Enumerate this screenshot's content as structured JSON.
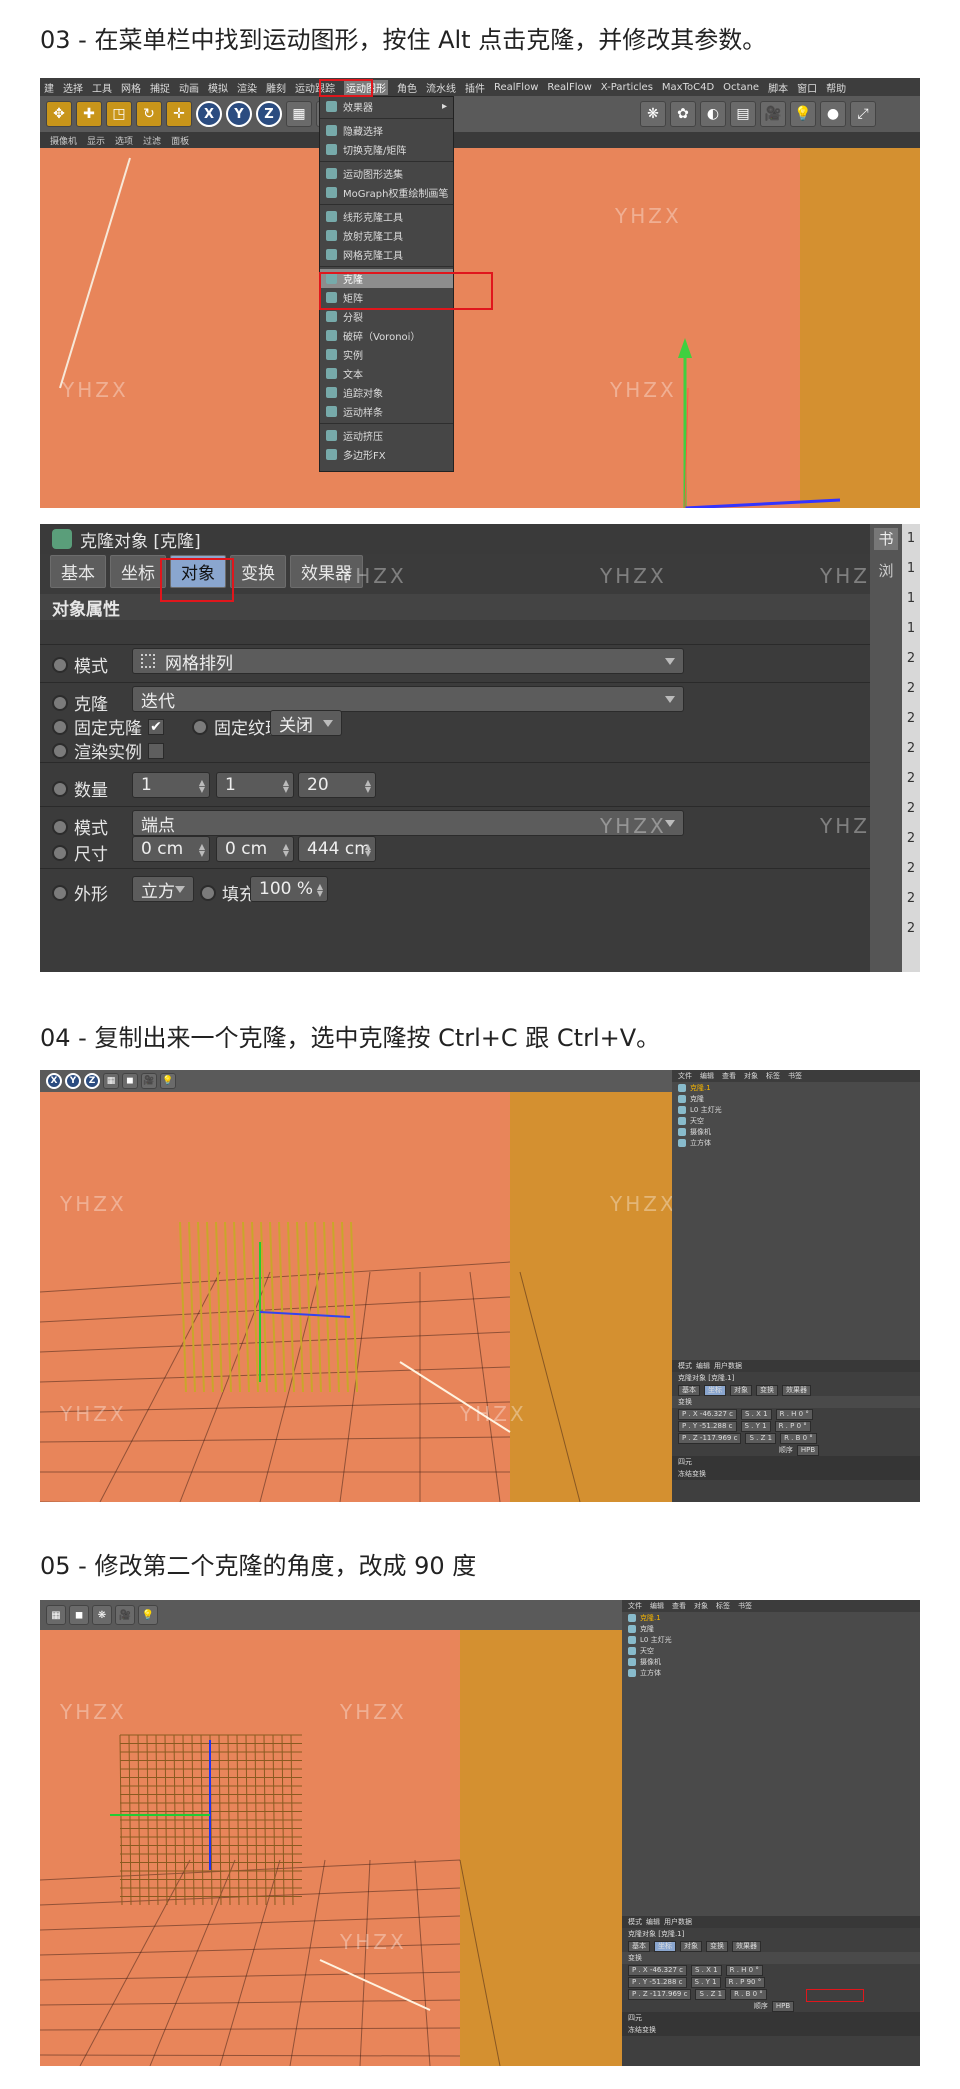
{
  "steps": {
    "s03": "03 - 在菜单栏中找到运动图形，按住 Alt 点击克隆，并修改其参数。",
    "s04": "04 - 复制出来一个克隆，选中克隆按 Ctrl+C 跟 Ctrl+V。",
    "s05": "05 - 修改第二个克隆的角度，改成 90 度"
  },
  "watermark": "YHZX",
  "menubar": [
    "建",
    "选择",
    "工具",
    "网格",
    "捕捉",
    "动画",
    "模拟",
    "渲染",
    "雕刻",
    "运动跟踪",
    "运动图形",
    "角色",
    "流水线",
    "插件",
    "RealFlow",
    "RealFlow",
    "X-Particles",
    "MaxToC4D",
    "Octane",
    "脚本",
    "窗口",
    "帮助"
  ],
  "toolbar_axes": [
    "X",
    "Y",
    "Z"
  ],
  "subbar": [
    "摄像机",
    "显示",
    "选项",
    "过滤",
    "面板"
  ],
  "mograph_menu": {
    "items": [
      {
        "label": "效果器",
        "submenu": true
      },
      {
        "label": "隐藏选择"
      },
      {
        "label": "切换克隆/矩阵"
      },
      {
        "label": "运动图形选集"
      },
      {
        "label": "MoGraph权重绘制画笔"
      },
      {
        "label": "线形克隆工具"
      },
      {
        "label": "放射克隆工具"
      },
      {
        "label": "网格克隆工具"
      },
      {
        "label": "克隆",
        "selected": true
      },
      {
        "label": "矩阵"
      },
      {
        "label": "分裂"
      },
      {
        "label": "破碎（Voronoi）"
      },
      {
        "label": "实例"
      },
      {
        "label": "文本"
      },
      {
        "label": "追踪对象"
      },
      {
        "label": "运动样条"
      },
      {
        "label": "运动挤压"
      },
      {
        "label": "多边形FX"
      }
    ]
  },
  "attr_panel": {
    "title": "克隆对象 [克隆]",
    "tabs": [
      "基本",
      "坐标",
      "对象",
      "变换",
      "效果器"
    ],
    "active_tab": "对象",
    "section": "对象属性",
    "mode_label": "模式",
    "mode_value": "网格排列",
    "clone_label": "克隆",
    "clone_value": "迭代",
    "fix_clone_label": "固定克隆",
    "fix_clone_check": "✔",
    "fix_texture_label": "固定纹理",
    "fix_texture_value": "关闭",
    "render_inst_label": "渲染实例",
    "count_label": "数量",
    "count_values": [
      "1",
      "1",
      "20"
    ],
    "mode2_label": "模式",
    "mode2_value": "端点",
    "size_label": "尺寸",
    "size_values": [
      "0 cm",
      "0 cm",
      "444 cm"
    ],
    "shape_label": "外形",
    "shape_value": "立方",
    "fill_label": "填充",
    "fill_value": "100 %",
    "right_glyphs": [
      "书",
      "浏"
    ],
    "right_numbers": [
      "1",
      "1",
      "1",
      "1",
      "2",
      "2",
      "2",
      "2",
      "2",
      "2",
      "2",
      "2",
      "2",
      "2"
    ]
  },
  "object_manager": {
    "header": [
      "文件",
      "编辑",
      "查看",
      "对象",
      "标签",
      "书签"
    ],
    "objects_04": [
      "克隆.1",
      "克隆",
      "L0 主灯光",
      "天空",
      "摄像机",
      "立方体"
    ],
    "objects_05": [
      "克隆.1",
      "克隆",
      "L0 主灯光",
      "天空",
      "摄像机",
      "立方体"
    ]
  },
  "attr_small": {
    "header": [
      "模式",
      "编辑",
      "用户数据"
    ],
    "title_04": "克隆对象 [克隆.1]",
    "title_05": "克隆对象 [克隆.1]",
    "tabs": [
      "基本",
      "坐标",
      "对象",
      "变换",
      "效果器"
    ],
    "section": "变换",
    "pos": [
      "P . X  -46.327 c",
      "P . Y  -51.288 c",
      "P . Z  -117.969 c"
    ],
    "scale": [
      "S . X  1",
      "S . Y  1",
      "S . Z  1"
    ],
    "rot_04": [
      "R . H  0 °",
      "R . P  0 °",
      "R . B  0 °"
    ],
    "rot_05": [
      "R . H  0 °",
      "R . P  90 °",
      "R . B  0 °"
    ],
    "order_label": "顺序",
    "order_value": "HPB",
    "footer": [
      "四元",
      "冻结变换"
    ]
  },
  "colors": {
    "viewport": "#e8855a",
    "wall": "#d49030",
    "highlight": "#e0161c",
    "active_tab": "#8aa6cf"
  }
}
